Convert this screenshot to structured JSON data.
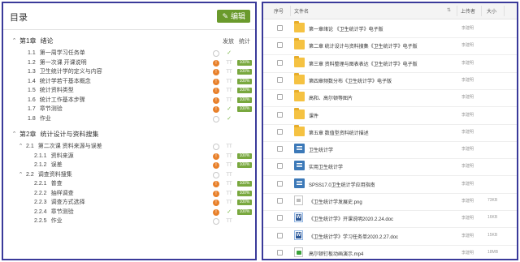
{
  "toc": {
    "title": "目录",
    "edit_label": "编辑",
    "col_publish": "发放",
    "col_stats": "统计",
    "rows": [
      {
        "level": "chapter",
        "num": "第1章",
        "text": "绪论",
        "expand": "⌃"
      },
      {
        "level": "section",
        "num": "1.1",
        "text": "第一周学习任务单",
        "status": "circle",
        "publish": "check"
      },
      {
        "level": "section",
        "num": "1.2",
        "text": "第一次课 开课说明",
        "status": "orange",
        "publish": "tt",
        "badge": "100%"
      },
      {
        "level": "section",
        "num": "1.3",
        "text": "卫生统计学的定义与内容",
        "status": "orange",
        "publish": "tt",
        "badge": "100%"
      },
      {
        "level": "section",
        "num": "1.4",
        "text": "统计学若干基本概念",
        "status": "orange",
        "publish": "tt",
        "badge": "100%"
      },
      {
        "level": "section",
        "num": "1.5",
        "text": "统计资料类型",
        "status": "orange",
        "publish": "tt",
        "badge": "100%"
      },
      {
        "level": "section",
        "num": "1.6",
        "text": "统计工作基本步骤",
        "status": "orange",
        "publish": "tt",
        "badge": "100%"
      },
      {
        "level": "section",
        "num": "1.7",
        "text": "章节测验",
        "status": "orange",
        "publish": "check",
        "badge": "100%"
      },
      {
        "level": "section",
        "num": "1.8",
        "text": "作业",
        "status": "circle",
        "publish": "check"
      },
      {
        "level": "chapter",
        "num": "第2章",
        "text": "统计设计与资料搜集",
        "expand": "⌃"
      },
      {
        "level": "sub",
        "num": "2.1",
        "text": "第二次课 资料来源与误差",
        "status": "circle",
        "publish": "tt",
        "expand": "⌃"
      },
      {
        "level": "subsub",
        "num": "2.1.1",
        "text": "资料来源",
        "status": "orange",
        "publish": "tt",
        "badge": "100%"
      },
      {
        "level": "subsub",
        "num": "2.1.2",
        "text": "误差",
        "status": "orange",
        "publish": "tt",
        "badge": "100%"
      },
      {
        "level": "sub",
        "num": "2.2",
        "text": "调查资料搜集",
        "status": "circle",
        "publish": "tt",
        "expand": "⌃"
      },
      {
        "level": "subsub",
        "num": "2.2.1",
        "text": "普查",
        "status": "orange",
        "publish": "tt",
        "badge": "100%"
      },
      {
        "level": "subsub",
        "num": "2.2.2",
        "text": "抽样调查",
        "status": "orange",
        "publish": "tt",
        "badge": "100%"
      },
      {
        "level": "subsub",
        "num": "2.2.3",
        "text": "调查方式选择",
        "status": "orange",
        "publish": "tt",
        "badge": "100%"
      },
      {
        "level": "subsub",
        "num": "2.2.4",
        "text": "章节测验",
        "status": "orange",
        "publish": "check",
        "badge": "100%"
      },
      {
        "level": "subsub",
        "num": "2.2.5",
        "text": "作业",
        "status": "circle",
        "publish": "tt"
      }
    ]
  },
  "files": {
    "headers": {
      "index": "序号",
      "name": "文件名",
      "sort": "⇅",
      "uploader": "上传者",
      "size": "大小"
    },
    "rows": [
      {
        "icon": "folder",
        "name": "第一章绪论 《卫生统计学》电子版",
        "uploader": "李建明",
        "size": ""
      },
      {
        "icon": "folder",
        "name": "第二章 统计设计与资料搜集《卫生统计学》电子版",
        "uploader": "李建明",
        "size": ""
      },
      {
        "icon": "folder",
        "name": "第三章 资料整理与图表表达《卫生统计学》电子版",
        "uploader": "李建明",
        "size": ""
      },
      {
        "icon": "folder",
        "name": "第四章频数分布《卫生统计学》电子版",
        "uploader": "李建明",
        "size": ""
      },
      {
        "icon": "folder",
        "name": "高和、高尔顿等图片",
        "uploader": "李建明",
        "size": ""
      },
      {
        "icon": "folder",
        "name": "课件",
        "uploader": "李建明",
        "size": ""
      },
      {
        "icon": "folder",
        "name": "第五章 数值型资料统计描述",
        "uploader": "李建明",
        "size": ""
      },
      {
        "icon": "book",
        "name": "卫生统计学",
        "uploader": "李建明",
        "size": ""
      },
      {
        "icon": "book",
        "name": "实用卫生统计学",
        "uploader": "李建明",
        "size": ""
      },
      {
        "icon": "book",
        "name": "SPSS17.0卫生统计学应用指南",
        "uploader": "李建明",
        "size": ""
      },
      {
        "icon": "img",
        "name": "《卫生统计学发展史.png",
        "uploader": "李建明",
        "size": "73KB"
      },
      {
        "icon": "doc",
        "name": "《卫生统计学》开课说明2020.2.24.doc",
        "uploader": "李建明",
        "size": "16KB"
      },
      {
        "icon": "doc",
        "name": "《卫生统计学》学习任务单2020.2.27.doc",
        "uploader": "李建明",
        "size": "15KB"
      },
      {
        "icon": "vid",
        "name": "高尔顿钉板动画演示.mp4",
        "uploader": "李建明",
        "size": "18MB"
      }
    ]
  }
}
